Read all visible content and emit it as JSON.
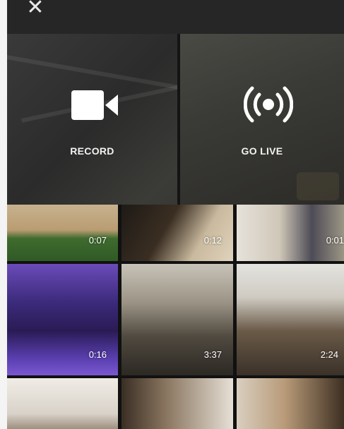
{
  "topbar": {
    "close_label": "✕"
  },
  "capture": {
    "record": {
      "label": "RECORD",
      "icon": "video-camera-icon"
    },
    "golive": {
      "label": "GO LIVE",
      "icon": "broadcast-icon"
    }
  },
  "videos": [
    {
      "duration": "0:07"
    },
    {
      "duration": "0:12"
    },
    {
      "duration": "0:01"
    },
    {
      "duration": "0:16"
    },
    {
      "duration": "3:37"
    },
    {
      "duration": "2:24"
    },
    {
      "duration": ""
    },
    {
      "duration": ""
    },
    {
      "duration": ""
    }
  ],
  "colors": {
    "overlay_bg": "#262626",
    "label_text": "#f2f2f2",
    "icon": "#ffffff"
  }
}
